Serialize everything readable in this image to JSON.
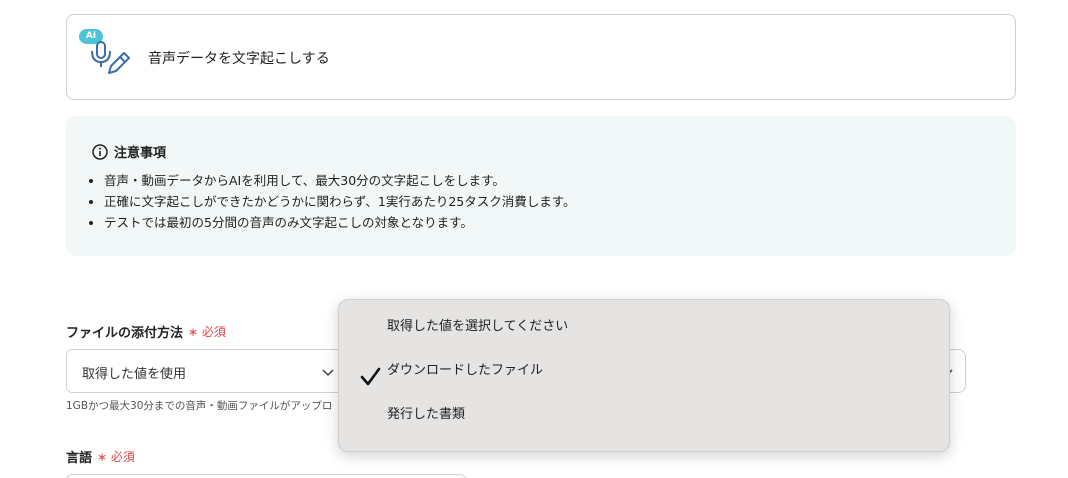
{
  "action": {
    "badge": "AI",
    "title": "音声データを文字起こしする"
  },
  "notice": {
    "title": "注意事項",
    "items": [
      "音声・動画データからAIを利用して、最大30分の文字起こしをします。",
      "正確に文字起こしができたかどうかに関わらず、1実行あたり25タスク消費します。",
      "テストでは最初の5分間の音声のみ文字起こしの対象となります。"
    ]
  },
  "form": {
    "attach_method": {
      "label": "ファイルの添付方法",
      "required": "必須",
      "selected": "取得した値を使用",
      "hint": "1GBかつ最大30分までの音声・動画ファイルがアップロ"
    },
    "language": {
      "label": "言語",
      "required": "必須"
    }
  },
  "dropdown": {
    "options": [
      "取得した値を選択してください",
      "ダウンロードしたファイル",
      "発行した書類"
    ],
    "checked_index": 1
  }
}
